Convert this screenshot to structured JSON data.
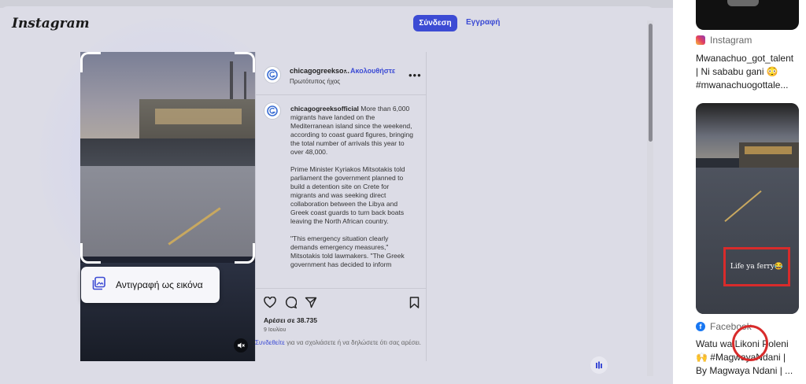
{
  "header": {
    "logo": "Instagram",
    "login_label": "Σύνδεση",
    "signup_label": "Εγγραφή"
  },
  "video": {
    "copy_image_label": "Αντιγραφή ως εικόνα",
    "copy_icon": "copy-image-icon",
    "mute_icon": "muted-speaker-icon"
  },
  "post": {
    "username_short": "chicagogreekso...",
    "separator": "•",
    "follow_label": "Ακολουθήστε",
    "audio_label": "Πρωτότυπος ήχος",
    "more_icon": "more-options-icon",
    "caption_user": "chicagogreeksofficial",
    "caption_p1": "More than 6,000 migrants have landed on the Mediterranean island since the weekend, according to coast guard figures, bringing the total number of arrivals this year to over 48,000.",
    "caption_p2": "Prime Minister Kyriakos Mitsotakis told parliament the government planned to build a detention site on Crete for migrants and was seeking direct collaboration between the Libya and Greek coast guards to turn back boats leaving the North African country.",
    "caption_p3": "\"This emergency situation clearly demands emergency measures,\" Mitsotakis told lawmakers. \"The Greek government has decided to inform",
    "likes": "Αρέσει σε 38.735",
    "date": "9 Ιουλίου",
    "login_link": "Συνδεθείτε",
    "login_text": " για να σχολιάσετε ή να δηλώσετε ότι σας αρέσει."
  },
  "sidebar": {
    "result1": {
      "source": "Instagram",
      "title_line1": "Mwanachuo_got_talent",
      "title_line2": "| Ni sababu gani 😳",
      "title_line3": "#mwanachuogottale..."
    },
    "result2": {
      "image_caption": "Life ya ferry😂",
      "source": "Facebook",
      "title_line1": "Watu wa Likoni Poleni",
      "title_line2": "🙌 #MagwayaNdani |",
      "title_line3": "By Magwaya Ndani | ..."
    }
  },
  "colors": {
    "accent": "#3c4bd4",
    "highlight_red": "#d82b2b"
  }
}
